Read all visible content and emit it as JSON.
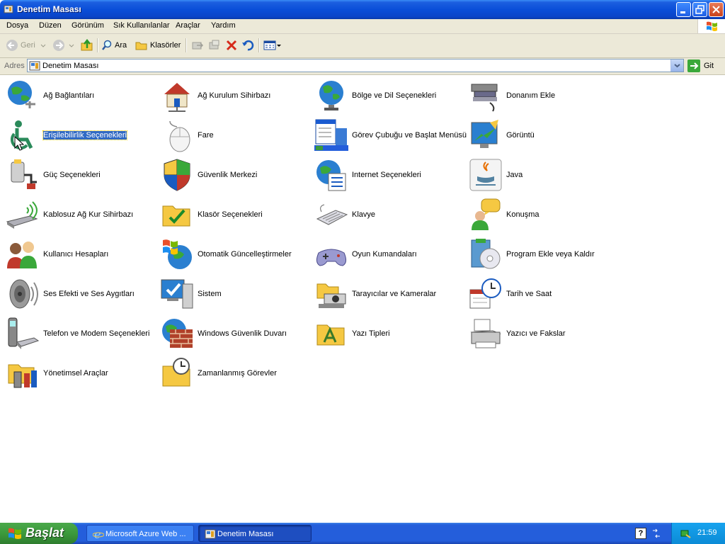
{
  "window": {
    "title": "Denetim Masası"
  },
  "menu": [
    "Dosya",
    "Düzen",
    "Görünüm",
    "Sık Kullanılanlar",
    "Araçlar",
    "Yardım"
  ],
  "toolbar": {
    "back_label": "Geri",
    "search_label": "Ara",
    "folders_label": "Klasörler"
  },
  "address": {
    "label": "Adres",
    "value": "Denetim Masası",
    "go_label": "Git"
  },
  "items": [
    {
      "label": "Ağ Bağlantıları",
      "icon": "network-connections-icon"
    },
    {
      "label": "Ağ Kurulum Sihirbazı",
      "icon": "network-setup-wizard-icon"
    },
    {
      "label": "Bölge ve Dil Seçenekleri",
      "icon": "regional-language-icon"
    },
    {
      "label": "Donanım Ekle",
      "icon": "add-hardware-icon"
    },
    {
      "label": "Erişilebilirlik Seçenekleri",
      "icon": "accessibility-icon",
      "selected": true
    },
    {
      "label": "Fare",
      "icon": "mouse-icon"
    },
    {
      "label": "Görev Çubuğu ve Başlat Menüsü",
      "icon": "taskbar-start-menu-icon"
    },
    {
      "label": "Görüntü",
      "icon": "display-icon"
    },
    {
      "label": "Güç Seçenekleri",
      "icon": "power-options-icon"
    },
    {
      "label": "Güvenlik Merkezi",
      "icon": "security-center-icon"
    },
    {
      "label": "Internet Seçenekleri",
      "icon": "internet-options-icon"
    },
    {
      "label": "Java",
      "icon": "java-icon"
    },
    {
      "label": "Kablosuz Ağ Kur Sihirbazı",
      "icon": "wireless-wizard-icon"
    },
    {
      "label": "Klasör Seçenekleri",
      "icon": "folder-options-icon"
    },
    {
      "label": "Klavye",
      "icon": "keyboard-icon"
    },
    {
      "label": "Konuşma",
      "icon": "speech-icon"
    },
    {
      "label": "Kullanıcı Hesapları",
      "icon": "user-accounts-icon"
    },
    {
      "label": "Otomatik Güncelleştirmeler",
      "icon": "automatic-updates-icon"
    },
    {
      "label": "Oyun Kumandaları",
      "icon": "game-controllers-icon"
    },
    {
      "label": "Program Ekle veya Kaldır",
      "icon": "add-remove-programs-icon"
    },
    {
      "label": "Ses Efekti ve Ses Aygıtları",
      "icon": "sounds-audio-icon"
    },
    {
      "label": "Sistem",
      "icon": "system-icon"
    },
    {
      "label": "Tarayıcılar ve Kameralar",
      "icon": "scanners-cameras-icon"
    },
    {
      "label": "Tarih ve Saat",
      "icon": "date-time-icon"
    },
    {
      "label": "Telefon ve Modem Seçenekleri",
      "icon": "phone-modem-icon"
    },
    {
      "label": "Windows Güvenlik Duvarı",
      "icon": "firewall-icon"
    },
    {
      "label": "Yazı Tipleri",
      "icon": "fonts-icon"
    },
    {
      "label": "Yazıcı ve Fakslar",
      "icon": "printers-faxes-icon"
    },
    {
      "label": "Yönetimsel Araçlar",
      "icon": "administrative-tools-icon"
    },
    {
      "label": "Zamanlanmış Görevler",
      "icon": "scheduled-tasks-icon"
    }
  ],
  "taskbar": {
    "start_label": "Başlat",
    "tasks": [
      {
        "label": "Microsoft Azure Web ...",
        "active": false
      },
      {
        "label": "Denetim Masası",
        "active": true
      }
    ],
    "clock": "21:59"
  }
}
